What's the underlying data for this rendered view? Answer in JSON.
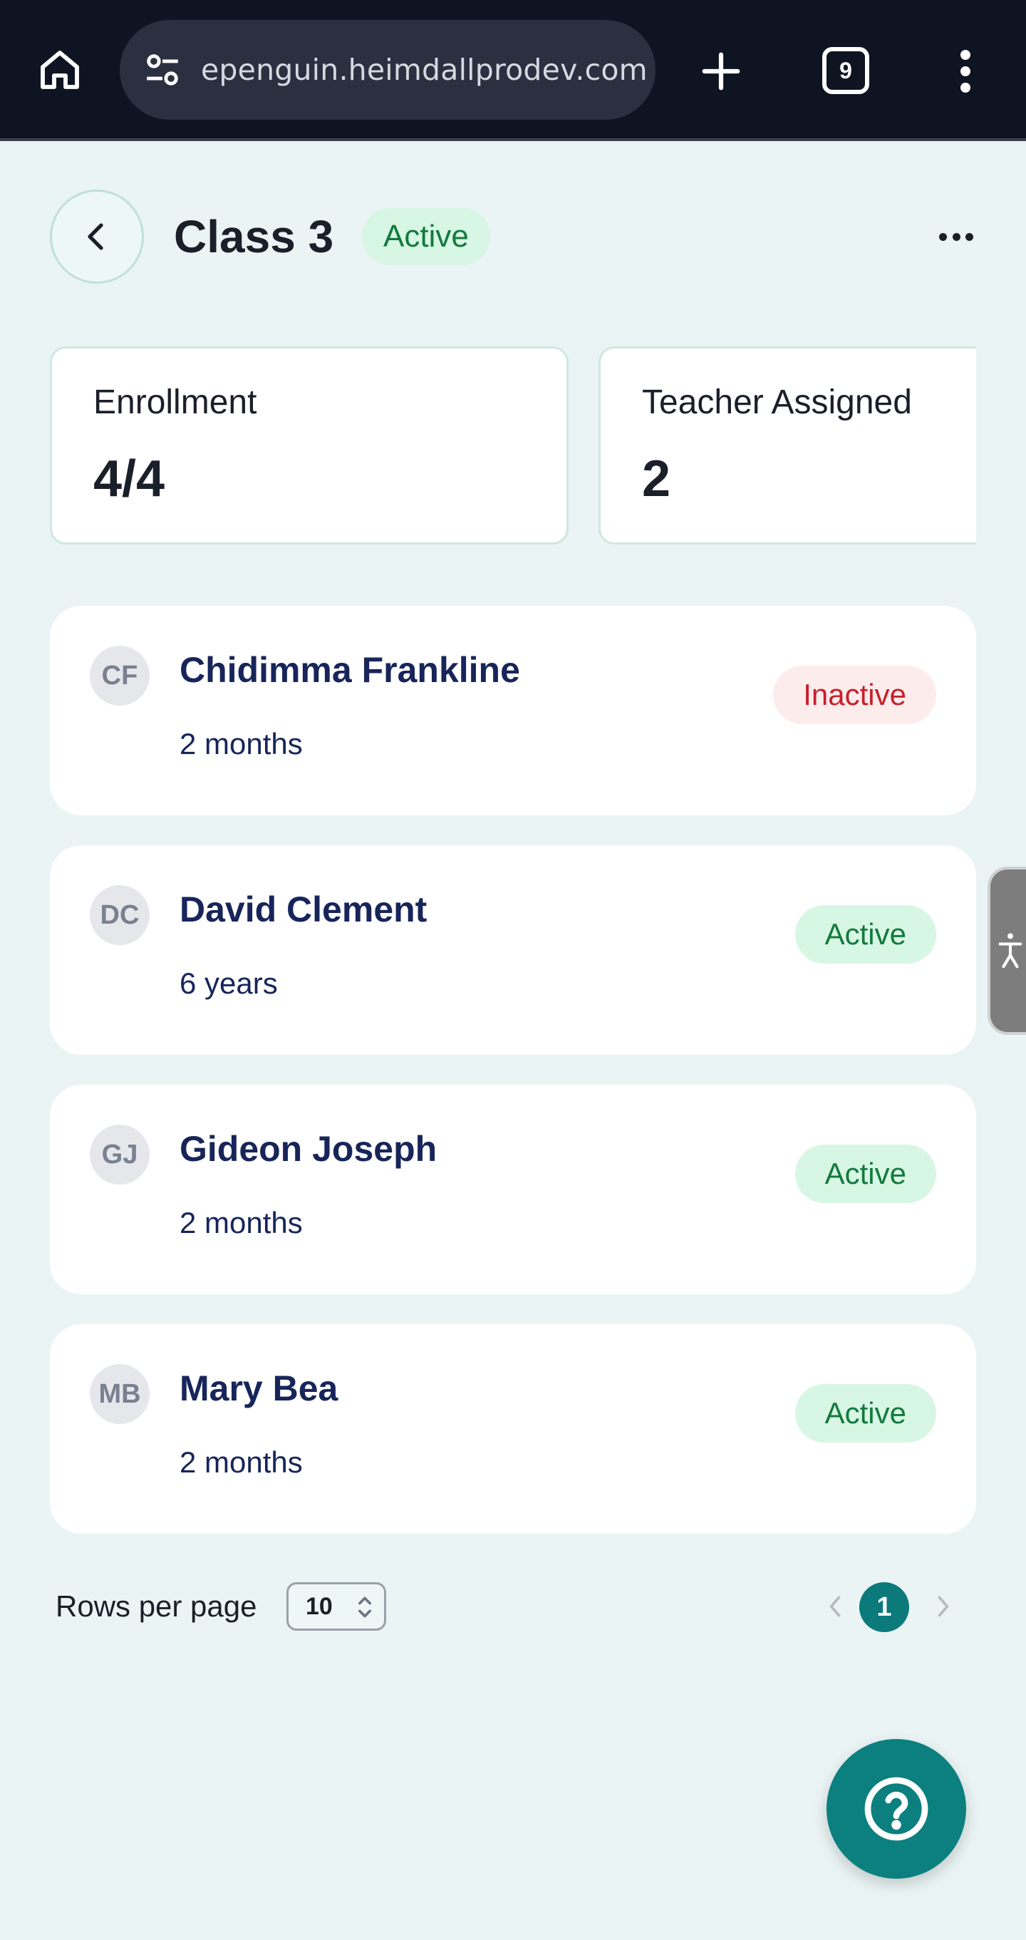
{
  "browser": {
    "url": "epenguin.heimdallprodev.com",
    "tab_count": "9"
  },
  "header": {
    "title": "Class 3",
    "status": "Active"
  },
  "stats": {
    "enrollment_label": "Enrollment",
    "enrollment_value": "4/4",
    "teacher_label": "Teacher Assigned",
    "teacher_value": "2"
  },
  "students": [
    {
      "initials": "CF",
      "name": "Chidimma Frankline",
      "duration": "2 months",
      "status": "Inactive"
    },
    {
      "initials": "DC",
      "name": "David Clement",
      "duration": "6 years",
      "status": "Active"
    },
    {
      "initials": "GJ",
      "name": "Gideon Joseph",
      "duration": "2 months",
      "status": "Active"
    },
    {
      "initials": "MB",
      "name": "Mary Bea",
      "duration": "2 months",
      "status": "Active"
    }
  ],
  "pagination": {
    "rows_label": "Rows per page",
    "rows_value": "10",
    "current_page": "1"
  },
  "colors": {
    "accent": "#0c7f7f",
    "active_bg": "#d8f6e4",
    "active_text": "#137a3d",
    "inactive_bg": "#fdecec",
    "inactive_text": "#c91f2b",
    "page_bg": "#eaf4f4"
  },
  "icons": {
    "home": "home-icon",
    "site_settings": "tune-icon",
    "new_tab": "plus-icon",
    "menu": "more-vert-icon",
    "back": "chevron-left-icon",
    "more": "more-horiz-icon",
    "accessibility": "accessibility-icon",
    "help": "help-circle-icon"
  }
}
